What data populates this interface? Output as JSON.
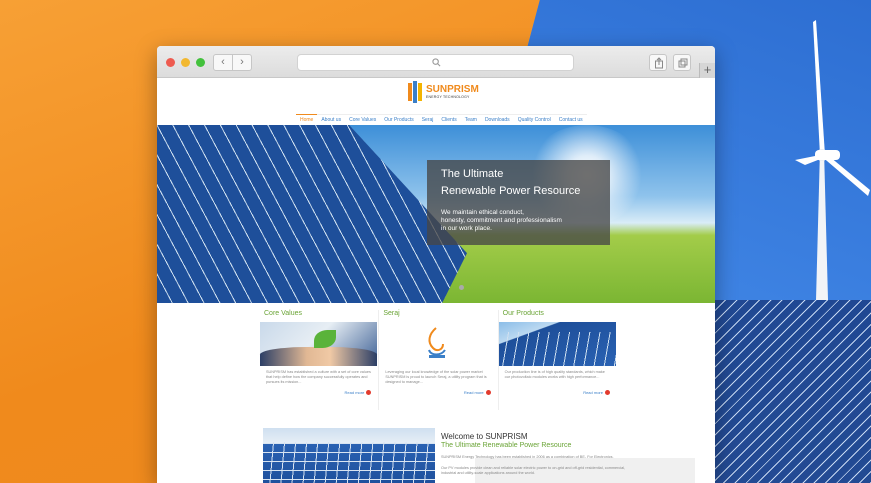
{
  "browser": {
    "back_label": "‹",
    "forward_label": "›",
    "new_tab_label": "+"
  },
  "site": {
    "logo_name": "SUNPRISM",
    "logo_tagline": "ENERGY TECHNOLOGY",
    "menu": [
      "Home",
      "About us",
      "Core Values",
      "Our Products",
      "Seraj",
      "Clients",
      "Team",
      "Downloads",
      "Quality Control",
      "Contact us"
    ],
    "hero": {
      "title_line1": "The Ultimate",
      "title_line2": "Renewable Power Resource",
      "text_line1": "We maintain ethical conduct,",
      "text_line2": "honesty, commitment and professionalism",
      "text_line3": "in our work place."
    },
    "columns": [
      {
        "title": "Core Values",
        "text": "SUNPRISM has established a culture with a set of core values that help define how the company successfully operates and pursues its mission...",
        "read_more": "Read more"
      },
      {
        "title": "Seraj",
        "text": "Leveraging our local knowledge of the solar power market SUNPRISM is proud to launch Seraj, a utility program that is designed to manage...",
        "read_more": "Read more"
      },
      {
        "title": "Our Products",
        "text": "Our production line is of high quality standards, which make our photovoltaic modules works with high performance...",
        "read_more": "Read more"
      }
    ],
    "welcome": {
      "title": "Welcome to SUNPRISM",
      "subtitle": "The Ultimate Renewable Power Resource",
      "text1": "SUNPRISM Energy Technology has been established in 2006 as a combination of BE- For Electronics.",
      "text2": "Our PV modules provide clean and reliable solar electric power to on-grid and off-grid residential, commercial, industrial and utility-scale applications around the world."
    }
  },
  "colors": {
    "accent_orange": "#f08a1c",
    "accent_green": "#6aa436",
    "link_blue": "#3a7fc8"
  }
}
